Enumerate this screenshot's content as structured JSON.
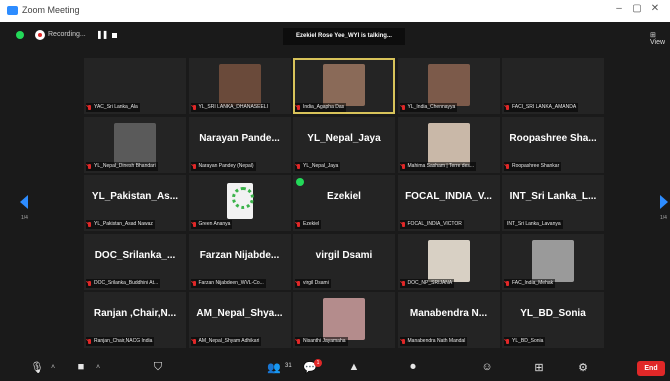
{
  "window": {
    "title": "Zoom Meeting",
    "controls": [
      "–",
      "▢",
      "✕"
    ]
  },
  "topbar": {
    "recording_label": "Recording...",
    "talking_label": "Ezekiel Rose Yee_WYI is talking...",
    "view_label": "⊞ View"
  },
  "pagination": {
    "left": "1/4",
    "right": "1/4"
  },
  "tiles": [
    {
      "name": "",
      "label": "YAC_Sri Lanka_Ala",
      "muted": true,
      "type": "empty"
    },
    {
      "name": "",
      "label": "YL_SRI LANKA_DHANASEELI",
      "muted": true,
      "type": "video",
      "photo": "#6a4a3a"
    },
    {
      "name": "",
      "label": "India_Agapha Das",
      "muted": true,
      "type": "video",
      "photo": "#8a6a58",
      "speaking": true
    },
    {
      "name": "",
      "label": "YL_India_Chennayya",
      "muted": true,
      "type": "video",
      "photo": "#7c5a4a"
    },
    {
      "name": "",
      "label": "FACI_SRI LANKA_AMANDA",
      "muted": true,
      "type": "empty"
    },
    {
      "name": "",
      "label": "YL_Nepal_Dinesh Bhandari",
      "muted": true,
      "type": "video",
      "photo": "#5a5a5a"
    },
    {
      "name": "Narayan Pande...",
      "label": "Narayan Pandey (Nepal)",
      "muted": true,
      "type": "name"
    },
    {
      "name": "YL_Nepal_Jaya",
      "label": "YL_Nepal_Jaya",
      "muted": true,
      "type": "name"
    },
    {
      "name": "",
      "label": "Mahima Sasham | Terre des...",
      "muted": true,
      "type": "video",
      "photo": "#c9b8a8"
    },
    {
      "name": "Roopashree Sha...",
      "label": "Roopashree Shankar",
      "muted": true,
      "type": "name"
    },
    {
      "name": "YL_Pakistan_As...",
      "label": "YL_Pakistan_Asad Nawaz",
      "muted": true,
      "type": "name"
    },
    {
      "name": "",
      "label": "Green Ananya",
      "muted": true,
      "type": "logo"
    },
    {
      "name": "Ezekiel",
      "label": "Ezekiel",
      "muted": true,
      "type": "name",
      "badge": true
    },
    {
      "name": "FOCAL_INDIA_V...",
      "label": "FOCAL_INDIA_VICTOR",
      "muted": true,
      "type": "name"
    },
    {
      "name": "INT_Sri Lanka_L...",
      "label": "INT_Sri Lanka_Lavanya",
      "muted": false,
      "type": "name"
    },
    {
      "name": "DOC_Srilanka_...",
      "label": "DOC_Srilanka_Buddhini At...",
      "muted": true,
      "type": "name"
    },
    {
      "name": "Farzan Nijabde...",
      "label": "Farzan Nijabdeen_WVL-Co...",
      "muted": true,
      "type": "name"
    },
    {
      "name": "virgil Dsami",
      "label": "virgil Dsami",
      "muted": true,
      "type": "name"
    },
    {
      "name": "",
      "label": "DOC_NP_SRIJANA",
      "muted": true,
      "type": "video",
      "photo": "#d8d0c4"
    },
    {
      "name": "",
      "label": "FAC_India_Mehak",
      "muted": true,
      "type": "video",
      "photo": "#9a9a9a"
    },
    {
      "name": "Ranjan ,Chair,N...",
      "label": "Ranjan_Chair,NACG India",
      "muted": true,
      "type": "name"
    },
    {
      "name": "AM_Nepal_Shya...",
      "label": "AM_Nepal_Shyam Adhikari",
      "muted": true,
      "type": "name"
    },
    {
      "name": "",
      "label": "Nisanthi Jayamaha",
      "muted": true,
      "type": "video",
      "photo": "#b48c8c"
    },
    {
      "name": "Manabendra N...",
      "label": "Manabendra Nath Mandal",
      "muted": true,
      "type": "name"
    },
    {
      "name": "YL_BD_Sonia",
      "label": "YL_BD_Sonia",
      "muted": true,
      "type": "name"
    }
  ],
  "toolbar": {
    "mic_icon": "microphone-icon",
    "video_icon": "video-icon",
    "security_icon": "shield-icon",
    "participants_count": "31",
    "chat_badge": "1",
    "end_label": "End"
  },
  "colors": {
    "accent": "#2d8cff",
    "end": "#e02828",
    "speaking": "#d8c35a",
    "status_green": "#23d959"
  }
}
